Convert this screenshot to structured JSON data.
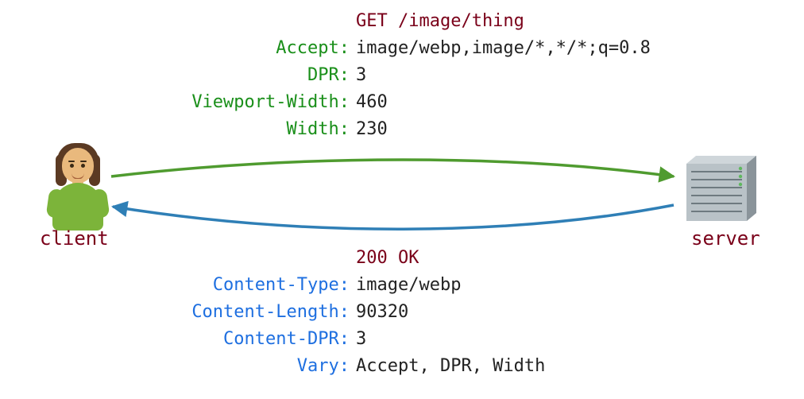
{
  "client_label": "client",
  "server_label": "server",
  "request": {
    "line": "GET /image/thing",
    "headers": [
      {
        "name": "Accept",
        "value": "image/webp,image/*,*/*;q=0.8"
      },
      {
        "name": "DPR",
        "value": "3"
      },
      {
        "name": "Viewport-Width",
        "value": "460"
      },
      {
        "name": "Width",
        "value": "230"
      }
    ]
  },
  "response": {
    "line": "200 OK",
    "headers": [
      {
        "name": "Content-Type",
        "value": "image/webp"
      },
      {
        "name": "Content-Length",
        "value": "90320"
      },
      {
        "name": "Content-DPR",
        "value": "3"
      },
      {
        "name": "Vary",
        "value": "Accept, DPR, Width"
      }
    ]
  },
  "colors": {
    "request_arrow": "#4f9b2f",
    "response_arrow": "#2f7fb6",
    "dark_red": "#7a0019"
  }
}
